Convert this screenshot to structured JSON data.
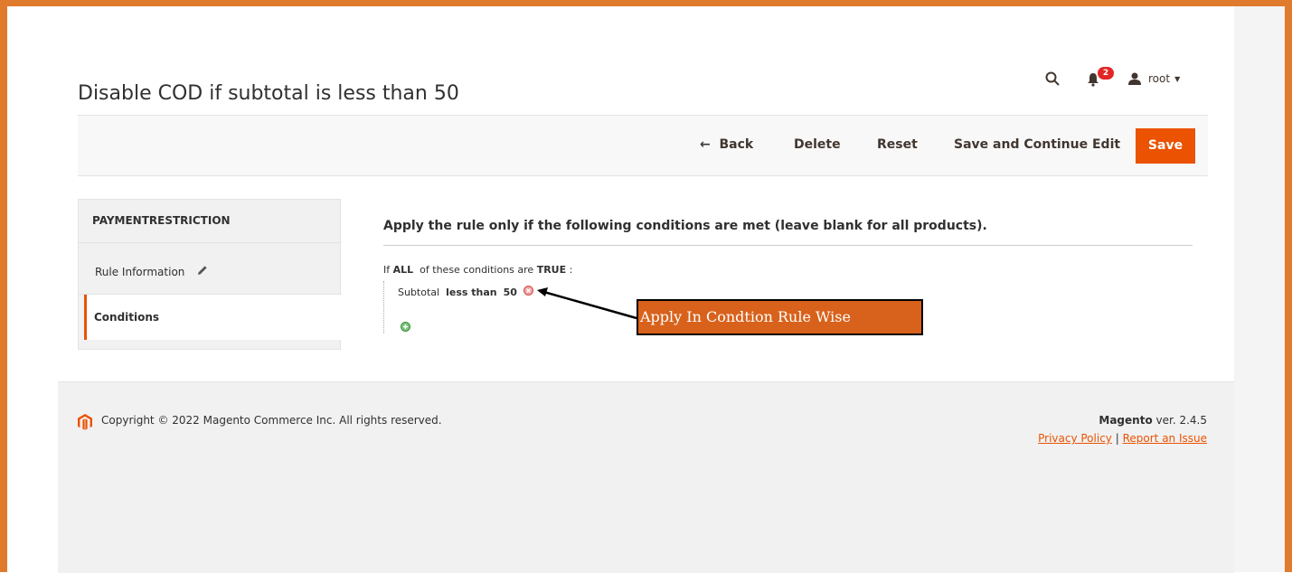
{
  "page": {
    "title": "Disable COD if subtotal is less than 50"
  },
  "header": {
    "notification_count": "2",
    "user_name": "root",
    "icons": [
      "search-icon",
      "bell-icon",
      "user-icon",
      "caret-down-icon"
    ]
  },
  "actions": {
    "back": "Back",
    "delete": "Delete",
    "reset": "Reset",
    "save_continue": "Save and Continue Edit",
    "save": "Save"
  },
  "sidebar": {
    "title": "PAYMENTRESTRICTION",
    "items": [
      {
        "label": "Rule Information",
        "icon": "pencil-icon"
      },
      {
        "label": "Conditions",
        "active": true
      }
    ]
  },
  "conditions": {
    "heading": "Apply the rule only if the following conditions are met (leave blank for all products).",
    "line1_prefix": "If",
    "line1_aggregator": "ALL",
    "line1_middle": "of these conditions are",
    "line1_value": "TRUE",
    "line1_suffix": ":",
    "rule_attribute": "Subtotal",
    "rule_operator": "less than",
    "rule_value": "50"
  },
  "annotation": {
    "text": "Apply In Condtion Rule Wise"
  },
  "footer": {
    "copyright": "Copyright © 2022 Magento Commerce Inc. All rights reserved.",
    "brand": "Magento",
    "version": "ver. 2.4.5",
    "privacy": "Privacy Policy",
    "separator": "|",
    "report": "Report an Issue"
  },
  "colors": {
    "frame": "#e07b2e",
    "accent": "#eb5202",
    "annotation_bg": "#d8621c"
  }
}
